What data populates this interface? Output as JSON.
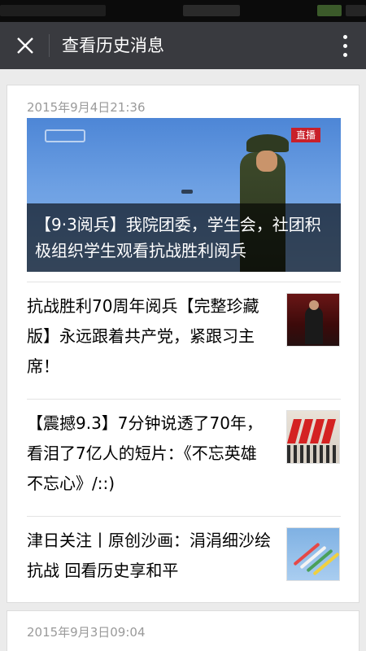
{
  "header": {
    "title": "查看历史消息"
  },
  "groups": [
    {
      "timestamp": "2015年9月4日21:36",
      "cover": {
        "caption": "【9·3阅兵】我院团委，学生会，社团积极组织学生观看抗战胜利阅兵",
        "badge": "直播"
      },
      "articles": [
        {
          "title": "抗战胜利70周年阅兵【完整珍藏版】永远跟着共产党，紧跟习主席！"
        },
        {
          "title": "【震撼9.3】7分钟说透了70年，看泪了7亿人的短片：《不忘英雄不忘心》/::)"
        },
        {
          "title": "津日关注丨原创沙画：涓涓细沙绘抗战 回看历史享和平"
        }
      ]
    },
    {
      "timestamp": "2015年9月3日09:04"
    }
  ],
  "icons": {
    "close": "close-icon",
    "more": "more-vertical-icon"
  },
  "colors": {
    "title_bar": "#393a3f",
    "background": "#ebebeb",
    "timestamp": "#9a9a9a"
  }
}
